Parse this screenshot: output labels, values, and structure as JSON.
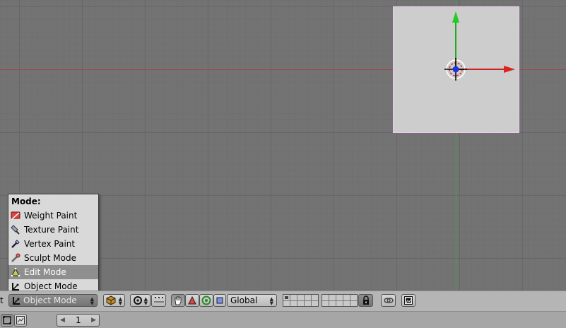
{
  "viewport": {
    "grid": "on"
  },
  "mode_menu": {
    "title": "Mode:",
    "items": [
      {
        "label": "Weight Paint",
        "icon": "weight-paint-icon"
      },
      {
        "label": "Texture Paint",
        "icon": "texture-paint-icon"
      },
      {
        "label": "Vertex Paint",
        "icon": "vertex-paint-icon"
      },
      {
        "label": "Sculpt Mode",
        "icon": "sculpt-mode-icon"
      },
      {
        "label": "Edit Mode",
        "icon": "edit-mode-icon",
        "highlighted": true
      },
      {
        "label": "Object Mode",
        "icon": "object-mode-icon"
      }
    ]
  },
  "header": {
    "truncated_label": "t",
    "mode_selector": "Object Mode",
    "orientation": "Global",
    "layers": {
      "rows": 2,
      "columns": 10
    }
  },
  "bottom_bar": {
    "frame_value": "1"
  },
  "colors": {
    "viewport_bg": "#737373",
    "x_axis": "#a04848",
    "y_axis": "#3aa43a",
    "plane": "#cdcdcd",
    "menu_bg": "#d9d9d9",
    "menu_highlight": "#8f8f8f"
  }
}
